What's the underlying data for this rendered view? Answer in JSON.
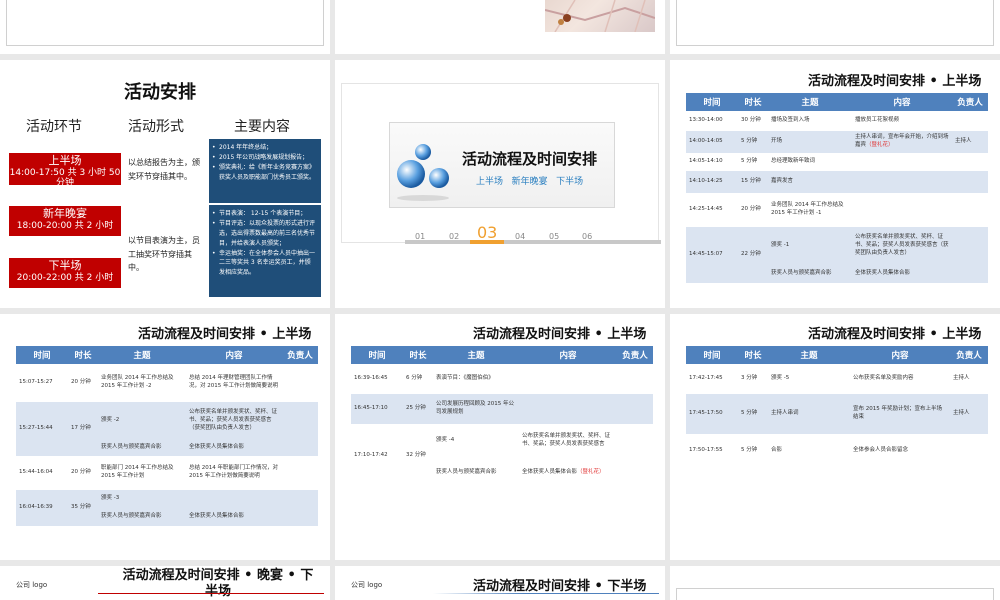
{
  "slide2": {
    "title": "活动安排",
    "col_headers": [
      "活动环节",
      "活动形式",
      "主要内容"
    ],
    "blocks": [
      {
        "name": "上半场",
        "time": "14:00-17:50 共 3 小时 50 分钟",
        "form": "以总结报告为主，颁奖环节穿插其中。"
      },
      {
        "name": "新年晚宴",
        "time": "18:00-20:00 共 2 小时",
        "form": ""
      },
      {
        "name": "下半场",
        "time": "20:00-22:00 共 2 小时",
        "form": "以节目表演为主，员工抽奖环节穿插其中。"
      }
    ],
    "content1": [
      "2014 年年终总结；",
      "2015 年公司战略发展规划报告；",
      "颁奖典礼：给《新年业务竞赛方案》获奖人员及职能部门优秀员工颁奖。"
    ],
    "content2": [
      "节目表演： 12-15 个表演节目；",
      "节目评选：以现众投票的形式进行评选，选出得票数最高的前三名优秀节目，并给表演人员颁奖；",
      "幸运抽奖：在全体参会人员中抽出一二三等奖共 3 名幸运奖员工，并颁发相应奖品。"
    ]
  },
  "slide3": {
    "title": "活动流程及时间安排",
    "subtitle": "上半场   新年晚宴   下半场",
    "steps": [
      "01",
      "02",
      "03",
      "04",
      "05",
      "06"
    ],
    "active_step": "03"
  },
  "table_headers": [
    "时间",
    "时长",
    "主题",
    "内容",
    "负责人"
  ],
  "slide4": {
    "title": "活动流程及时间安排 • 上半场",
    "rows": [
      {
        "time": "13:30-14:00",
        "dur": "30 分钟",
        "topic": "播场及签到入场",
        "content": "播放员工花絮视频",
        "owner": ""
      },
      {
        "time": "14:00-14:05",
        "dur": "5 分钟",
        "topic": "开场",
        "content": "主持人串词，宣布年会开始，介绍到场嘉宾",
        "content_red": "（暨礼花）",
        "owner": "主持人"
      },
      {
        "time": "14:05-14:10",
        "dur": "5 分钟",
        "topic": "总经理致新年致词",
        "content": "",
        "owner": ""
      },
      {
        "time": "14:10-14:25",
        "dur": "15 分钟",
        "topic": "嘉宾发言",
        "content": "",
        "owner": ""
      },
      {
        "time": "14:25-14:45",
        "dur": "20 分钟",
        "topic": "业务团队 2014 年工作总结及 2015 年工作计划 -1",
        "content": "",
        "owner": ""
      }
    ],
    "merged": {
      "time": "14:45-15:07",
      "dur": "22 分钟",
      "topic1": "颁奖 -1",
      "content1": "公布获奖名单并颁发奖状、奖杯、证书、奖品；获奖人员发表获奖感言（获奖团队由负责人发言）",
      "topic2": "获奖人员与颁奖嘉宾合影",
      "content2": "全体获奖人员集体合影"
    }
  },
  "slide5": {
    "title": "活动流程及时间安排 • 上半场",
    "row1": {
      "time": "15:07-15:27",
      "dur": "20 分钟",
      "topic": "业务团队 2014 年工作总结及 2015 年工作计划 -2",
      "content": "总结 2014 年理财管理团队工作情况，对 2015 年工作计划做简要说明"
    },
    "merged1": {
      "time": "15:27-15:44",
      "dur": "17 分钟",
      "topic1": "颁奖 -2",
      "content1": "公布获奖名单并颁发奖状、奖杯、证书、奖品；获奖人员发表获奖感言（获奖团队由负责人发言）",
      "topic2": "获奖人员与颁奖嘉宾合影",
      "content2": "全体获奖人员集体合影"
    },
    "row2": {
      "time": "15:44-16:04",
      "dur": "20 分钟",
      "topic": "职能部门 2014 年工作总结及 2015 年工作计划",
      "content": "总结 2014 年职能部门工作情况，对 2015 年工作计划做简要说明"
    },
    "merged2": {
      "time": "16:04-16:39",
      "dur": "35 分钟",
      "topic1": "颁奖 -3",
      "topic2": "获奖人员与颁奖嘉宾合影",
      "content2": "全体获奖人员集体合影"
    }
  },
  "slide6": {
    "title": "活动流程及时间安排 • 上半场",
    "row1": {
      "time": "16:39-16:45",
      "dur": "6 分钟",
      "topic": "表演节目：《魔图伯伯》"
    },
    "row2": {
      "time": "16:45-17:10",
      "dur": "25 分钟",
      "topic": "公司发展历程回顾及 2015 年公司发展规划"
    },
    "merged": {
      "time": "17:10-17:42",
      "dur": "32 分钟",
      "topic1": "颁奖 -4",
      "content1": "公布获奖名单并颁发奖状、奖杯、证书、奖品；获奖人员发表获奖感言",
      "topic2": "获奖人员与颁奖嘉宾合影",
      "content2": "全体获奖人员集体合影",
      "content2_red": "（暨礼花）"
    }
  },
  "slide7": {
    "title": "活动流程及时间安排 • 上半场",
    "rows": [
      {
        "time": "17:42-17:45",
        "dur": "3 分钟",
        "topic": "颁奖 -5",
        "content": "公布获奖名单及奖励内容",
        "owner": "主持人"
      },
      {
        "time": "17:45-17:50",
        "dur": "5 分钟",
        "topic": "主持人串词",
        "content": "宣布 2015 年奖励计划；宣布上半场结束",
        "owner": "主持人"
      },
      {
        "time": "17:50-17:55",
        "dur": "5 分钟",
        "topic": "合影",
        "content": "全体参会人员合影留念",
        "owner": ""
      }
    ]
  },
  "slide8": {
    "logo": "公司 logo",
    "title": "活动流程及时间安排 • 晚宴 • 下半场"
  },
  "slide9": {
    "logo": "公司 logo",
    "title": "活动流程及时间安排 • 下半场"
  },
  "colors": {
    "header_blue": "#4f81bd",
    "row_blue": "#dbe4f1",
    "block_red": "#c00000",
    "box_navy": "#1f4e79",
    "accent_orange": "#f0a030"
  }
}
